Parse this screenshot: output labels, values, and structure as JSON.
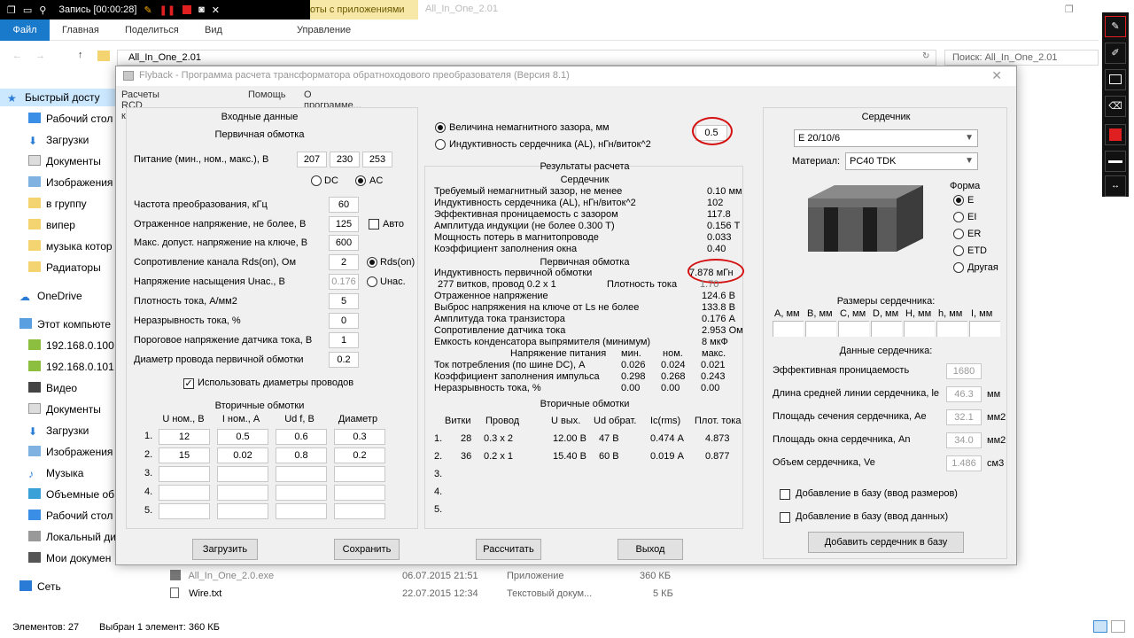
{
  "recorder": {
    "label": "Запись [00:00:28]"
  },
  "explorer": {
    "context_tab": "оты с приложениями",
    "window_title": "All_In_One_2.01",
    "ribbon": {
      "file": "Файл",
      "home": "Главная",
      "share": "Поделиться",
      "view": "Вид",
      "manage": "Управление"
    },
    "address": "All_In_One_2.01",
    "search_placeholder": "Поиск: All_In_One_2.01",
    "nav": [
      "Быстрый досту",
      "Рабочий стол",
      "Загрузки",
      "Документы",
      "Изображения",
      "в группу",
      "випер",
      "музыка котор",
      "Радиаторы",
      "OneDrive",
      "Этот компьюте",
      "192.168.0.100",
      "192.168.0.101",
      "Видео",
      "Документы",
      "Загрузки",
      "Изображения",
      "Музыка",
      "Объемные об",
      "Рабочий стол",
      "Локальный ди",
      "Мои докумен",
      "Сеть"
    ],
    "files": [
      {
        "name": "All_In_One_2.0.exe",
        "date": "06.07.2015 21:51",
        "type": "Приложение",
        "size": "360 КБ"
      },
      {
        "name": "Wire.txt",
        "date": "22.07.2015 12:34",
        "type": "Текстовый докум...",
        "size": "5 КБ"
      }
    ],
    "status": {
      "count": "Элементов: 27",
      "selected": "Выбран 1 элемент: 360 КБ"
    }
  },
  "dialog": {
    "title": "Flyback - Программа расчета трансформатора обратноходового преобразователя (Версия 8.1)",
    "menu": [
      "Расчеты RCD клампера",
      "Помощь",
      "О программе..."
    ],
    "input": {
      "header": "Входные данные",
      "primary_header": "Первичная обмотка",
      "supply_label": "Питание (мин., ном., макс.), В",
      "supply": [
        "207",
        "230",
        "253"
      ],
      "dc": "DC",
      "ac": "AC",
      "freq_label": "Частота преобразования, кГц",
      "freq": "60",
      "reflected_label": "Отраженное напряжение, не более, В",
      "reflected": "125",
      "auto": "Авто",
      "vmax_label": "Макс. допуст. напряжение на ключе, В",
      "vmax": "600",
      "rds_label": "Сопротивление канала Rds(on), Ом",
      "rds": "2",
      "rds_radio": "Rds(on)",
      "usat_label": "Напряжение насыщения Uнас., В",
      "usat": "0.176",
      "usat_radio": "Uнас.",
      "j_label": "Плотность тока, А/мм2",
      "j": "5",
      "cont_label": "Неразрывность тока, %",
      "cont": "0",
      "sense_label": "Пороговое напряжение датчика тока, В",
      "sense": "1",
      "wire_label": "Диаметр провода первичной обмотки",
      "wire": "0.2",
      "use_wire": "Использовать диаметры проводов",
      "sec_header": "Вторичные обмотки",
      "sec_cols": [
        "U ном., В",
        "I ном., А",
        "Ud f, В",
        "Диаметр"
      ],
      "sec_rows": [
        {
          "n": "1.",
          "v": [
            "12",
            "0.5",
            "0.6",
            "0.3"
          ]
        },
        {
          "n": "2.",
          "v": [
            "15",
            "0.02",
            "0.8",
            "0.2"
          ]
        },
        {
          "n": "3.",
          "v": [
            "",
            "",
            "",
            ""
          ]
        },
        {
          "n": "4.",
          "v": [
            "",
            "",
            "",
            ""
          ]
        },
        {
          "n": "5.",
          "v": [
            "",
            "",
            "",
            ""
          ]
        }
      ]
    },
    "gap": {
      "opt1": "Величина немагнитного зазора, мм",
      "opt2": "Индуктивность сердечника (AL), нГн/виток^2",
      "value": "0.5"
    },
    "results": {
      "header": "Результаты расчета",
      "core_header": "Сердечник",
      "core": [
        {
          "l": "Требуемый немагнитный зазор, не менее",
          "v": "0.10 мм"
        },
        {
          "l": "Индуктивность сердечника (AL), нГн/виток^2",
          "v": "102"
        },
        {
          "l": "Эффективная проницаемость с зазором",
          "v": "117.8"
        },
        {
          "l": "Амплитуда индукции           (не более 0.300 Т)",
          "v": "0.156 Т"
        },
        {
          "l": "Мощность потерь в магнитопроводе",
          "v": "0.033"
        },
        {
          "l": "Коэффициент заполнения окна",
          "v": "0.40"
        }
      ],
      "primary_header": "Первичная обмотка",
      "inductance_label": "Индуктивность первичной обмотки",
      "inductance": "7.878 мГн",
      "turns": "277 витков, провод 0.2 x 1",
      "density_label": "Плотность тока",
      "density": "1.70",
      "primary": [
        {
          "l": "Отраженное напряжение",
          "v": "124.6 В"
        },
        {
          "l": "Выброс напряжения на ключе от Ls не более",
          "v": "133.8 В"
        },
        {
          "l": "Амплитуда тока транзистора",
          "v": "0.176 А"
        },
        {
          "l": "Сопротивление датчика тока",
          "v": "2.953 Ом"
        },
        {
          "l": "Емкость конденсатора выпрямителя (минимум)",
          "v": "8 мкФ"
        }
      ],
      "supply_cols": [
        "Напряжение питания",
        "мин.",
        "ном.",
        "макс."
      ],
      "supply_rows": [
        {
          "l": "Ток потребления (по шине DC), А",
          "v": [
            "0.026",
            "0.024",
            "0.021"
          ]
        },
        {
          "l": "Коэффициент заполнения импульса",
          "v": [
            "0.298",
            "0.268",
            "0.243"
          ]
        },
        {
          "l": "Неразрывность тока, %",
          "v": [
            "0.00",
            "0.00",
            "0.00"
          ]
        }
      ],
      "sec_header": "Вторичные обмотки",
      "sec_cols": [
        "Витки",
        "Провод",
        "U вых.",
        "Ud обрат.",
        "Ic(rms)",
        "Плот. тока"
      ],
      "sec_rows": [
        {
          "n": "1.",
          "v": [
            "28",
            "0.3 x 2",
            "12.00 В",
            "47 В",
            "0.474 А",
            "4.873"
          ]
        },
        {
          "n": "2.",
          "v": [
            "36",
            "0.2 x 1",
            "15.40 В",
            "60 В",
            "0.019 А",
            "0.877"
          ]
        },
        {
          "n": "3.",
          "v": [
            "",
            "",
            "",
            "",
            "",
            ""
          ]
        },
        {
          "n": "4.",
          "v": [
            "",
            "",
            "",
            "",
            "",
            ""
          ]
        },
        {
          "n": "5.",
          "v": [
            "",
            "",
            "",
            "",
            "",
            ""
          ]
        }
      ]
    },
    "core": {
      "header": "Сердечник",
      "model": "E 20/10/6",
      "material_label": "Материал:",
      "material": "PC40 TDK",
      "shape_label": "Форма",
      "shapes": [
        "E",
        "EI",
        "ER",
        "ETD",
        "Другая"
      ],
      "dims_header": "Размеры сердечника:",
      "dims": [
        "A, мм",
        "B, мм",
        "C, мм",
        "D, мм",
        "H, мм",
        "h, мм",
        "I, мм"
      ],
      "data_header": "Данные сердечника:",
      "data": [
        {
          "l": "Эффективная проницаемость",
          "v": "1680",
          "u": ""
        },
        {
          "l": "Длина средней линии сердечника, le",
          "v": "46.3",
          "u": "мм"
        },
        {
          "l": "Площадь сечения сердечника, Ae",
          "v": "32.1",
          "u": "мм2"
        },
        {
          "l": "Площадь окна сердечника, An",
          "v": "34.0",
          "u": "мм2"
        },
        {
          "l": "Объем сердечника, Ve",
          "v": "1.486",
          "u": "см3"
        }
      ],
      "add_dims": "Добавление в базу (ввод размеров)",
      "add_data": "Добавление в базу (ввод данных)",
      "add_btn": "Добавить сердечник в базу"
    },
    "buttons": {
      "load": "Загрузить",
      "save": "Сохранить",
      "calc": "Рассчитать",
      "exit": "Выход"
    }
  }
}
